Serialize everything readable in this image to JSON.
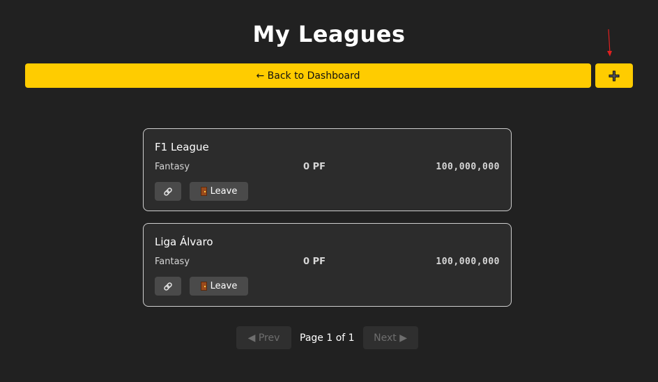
{
  "header": {
    "title": "My Leagues"
  },
  "toolbar": {
    "back_label": "← Back to Dashboard",
    "add_label": "+"
  },
  "leagues": [
    {
      "name": "F1 League",
      "type": "Fantasy",
      "points": "0 PF",
      "budget": "100,000,000",
      "leave_label": "Leave"
    },
    {
      "name": "Liga Álvaro",
      "type": "Fantasy",
      "points": "0 PF",
      "budget": "100,000,000",
      "leave_label": "Leave"
    }
  ],
  "pagination": {
    "prev_label": "◀ Prev",
    "page_text": "Page 1 of 1",
    "next_label": "Next ▶"
  },
  "colors": {
    "accent": "#ffcc00",
    "background": "#212121",
    "card": "#2c2c2c",
    "annotation_arrow": "#e02020"
  }
}
